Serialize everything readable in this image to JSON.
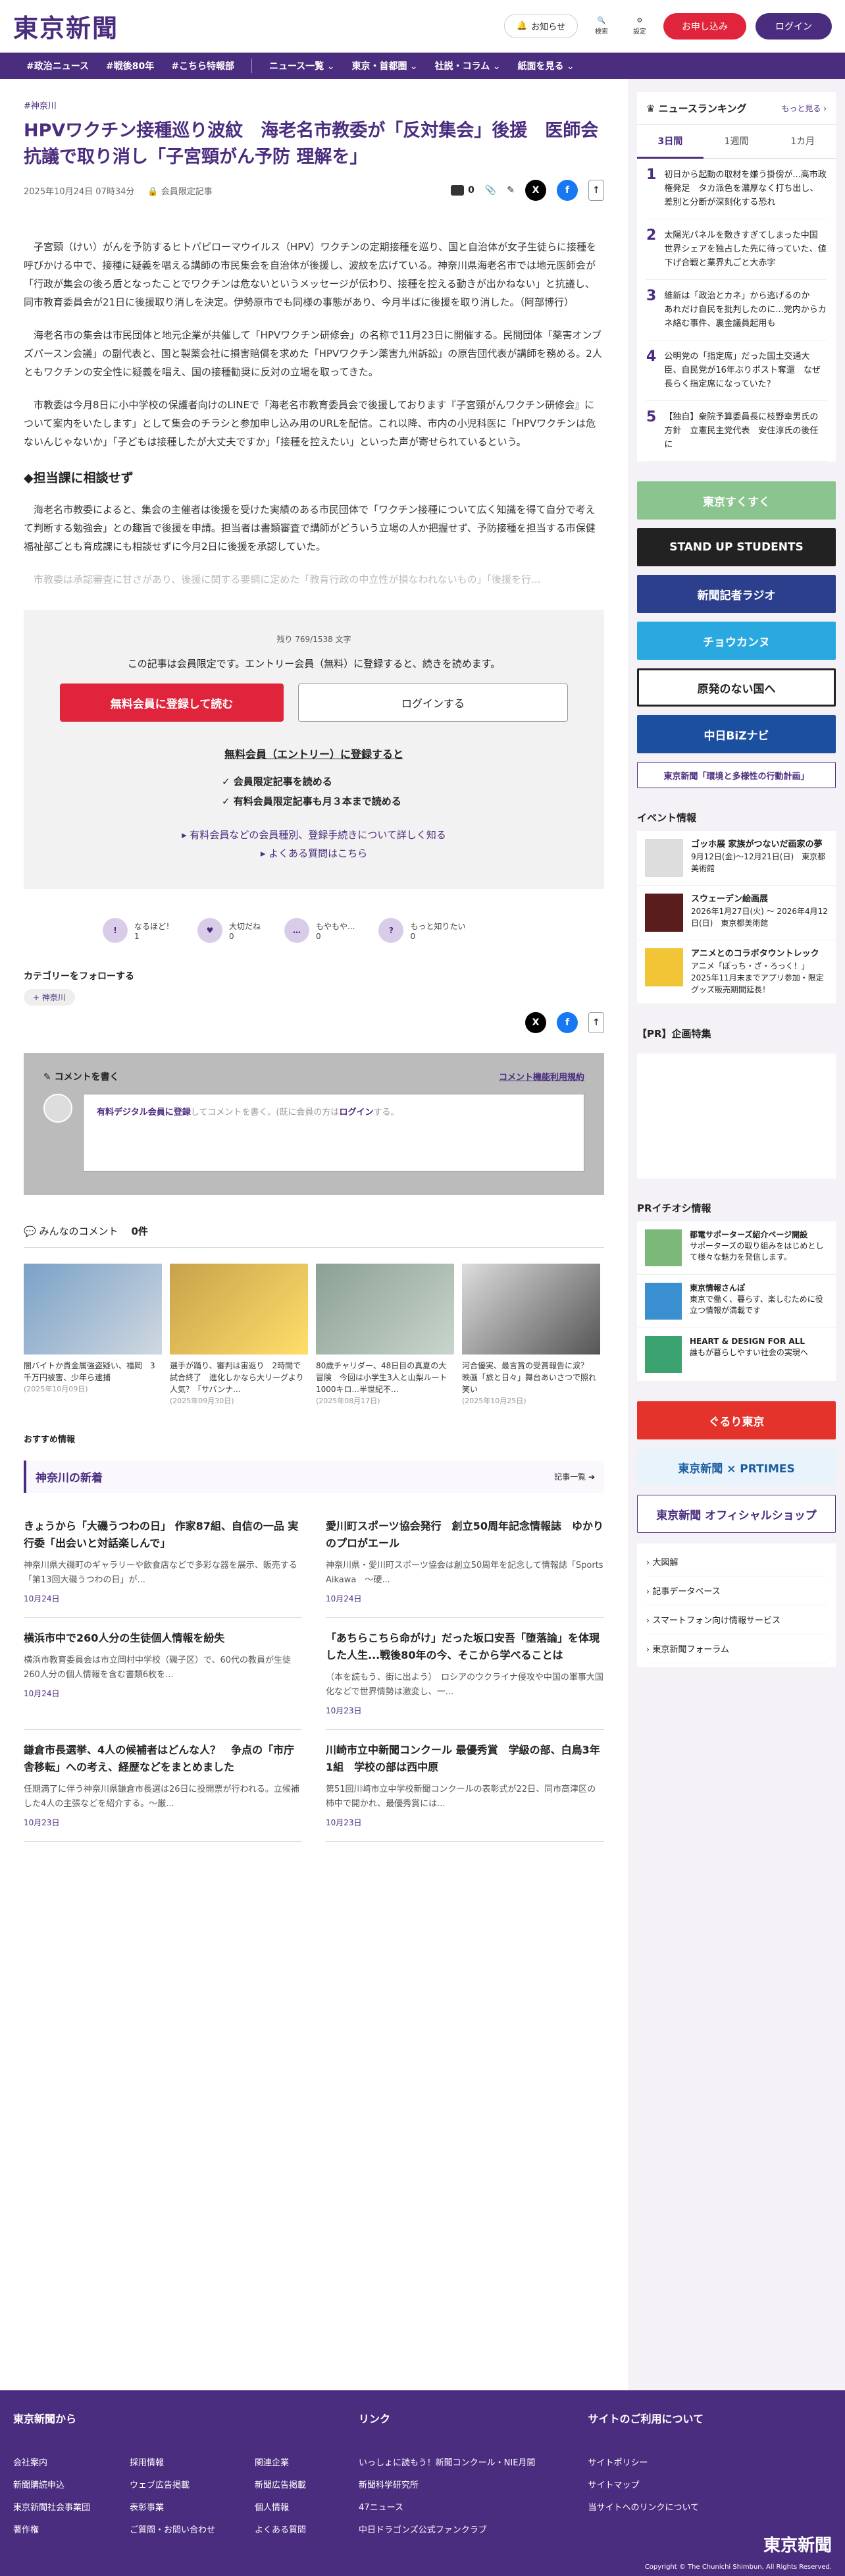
{
  "header": {
    "logo": "東京新聞",
    "notice": "お知らせ",
    "search": "検索",
    "settings": "設定",
    "apply": "お申し込み",
    "login": "ログイン"
  },
  "nav": [
    "#政治ニュース",
    "#戦後80年",
    "#こちら特報部",
    "ニュース一覧",
    "東京・首都圏",
    "社説・コラム",
    "紙面を見る"
  ],
  "article": {
    "tag": "#神奈川",
    "title": "HPVワクチン接種巡り波紋　海老名市教委が「反対集会」後援　医師会抗議で取り消し「子宮頸がん予防 理解を」",
    "date": "2025年10月24日 07時34分",
    "members_only": "会員限定記事",
    "comment_count": "0",
    "p1": "子宮頸（けい）がんを予防するヒトパピローマウイルス（HPV）ワクチンの定期接種を巡り、国と自治体が女子生徒らに接種を呼びかける中で、接種に疑義を唱える講師の市民集会を自治体が後援し、波紋を広げている。神奈川県海老名市では地元医師会が「行政が集会の後ろ盾となったことでワクチンは危ないというメッセージが伝わり、接種を控える動きが出かねない」と抗議し、同市教育委員会が21日に後援取り消しを決定。伊勢原市でも同様の事態があり、今月半ばに後援を取り消した。（阿部博行）",
    "p2": "海老名市の集会は市民団体と地元企業が共催して「HPVワクチン研修会」の名称で11月23日に開催する。民間団体「薬害オンブズパースン会議」の副代表と、国と製薬会社に損害賠償を求めた「HPVワクチン薬害九州訴訟」の原告団代表が講師を務める。2人ともワクチンの安全性に疑義を唱え、国の接種勧奨に反対の立場を取ってきた。",
    "p3": "市教委は今月8日に小中学校の保護者向けのLINEで「海老名市教育委員会で後援しております『子宮頸がんワクチン研修会』について案内をいたします」として集会のチラシと参加申し込み用のURLを配信。これ以降、市内の小児科医に「HPVワクチンは危ないんじゃないか」「子どもは接種したが大丈夫ですか」「接種を控えたい」といった声が寄せられているという。",
    "h2": "◆担当課に相談せず",
    "p4": "海老名市教委によると、集会の主催者は後援を受けた実績のある市民団体で「ワクチン接種について広く知識を得て自分で考えて判断する勉強会」との趣旨で後援を申請。担当者は書類審査で講師がどういう立場の人か把握せず、予防接種を担当する市保健福祉部ごとも育成課にも相談せずに今月2日に後援を承認していた。",
    "p5": "市教委は承認審査に甘さがあり、後援に関する要綱に定めた「教育行政の中立性が損なわれないもの」「後援を行..."
  },
  "paywall": {
    "remaining": "残り 769/1538 文字",
    "message": "この記事は会員限定です。エントリー会員（無料）に登録すると、続きを読めます。",
    "register": "無料会員に登録して読む",
    "login": "ログインする",
    "sub_title": "無料会員（エントリー）に登録すると",
    "benefits": [
      "会員限定記事を読める",
      "有料会員限定記事も月３本まで読める"
    ],
    "link1": "有料会員などの会員種別、登録手続きについて詳しく知る",
    "link2": "よくある質問はこちら"
  },
  "reactions": [
    {
      "label": "なるほど！",
      "count": "1"
    },
    {
      "label": "大切だね",
      "count": "0"
    },
    {
      "label": "もやもや...",
      "count": "0"
    },
    {
      "label": "もっと知りたい",
      "count": "0"
    }
  ],
  "follow": {
    "title": "カテゴリーをフォローする",
    "chip": "神奈川"
  },
  "comment": {
    "title": "コメントを書く",
    "terms": "コメント機能利用規約",
    "placeholder_link": "有料デジタル会員に登録",
    "placeholder": "してコメントを書く。(既に会員の方は",
    "login": "ログイン",
    "placeholder_end": "する。"
  },
  "all_comments": {
    "title": "みんなのコメント",
    "count": "0件"
  },
  "cards": [
    {
      "text": "闇バイトか貴金属強盗疑い、福岡　3千万円被害、少年ら逮捕",
      "date": "(2025年10月09日)"
    },
    {
      "text": "選手が踊り、審判は宙返り　2時間で試合終了　進化しかなら大リーグより人気？「サバンナ...",
      "date": "(2025年09月30日)"
    },
    {
      "text": "80歳チャリダー、48日目の真夏の大冒険　今回は小学生3人と山梨ルート1000キロ...半世紀不...",
      "date": "(2025年08月17日)"
    },
    {
      "text": "河合優実、最言賞の受賞報告に涙？　映画「旅と日々」舞台あいさつで照れ笑い",
      "date": "(2025年10月25日)"
    }
  ],
  "recommend": "おすすめ情報",
  "local": {
    "title": "神奈川の新着",
    "more": "記事一覧",
    "items": [
      {
        "title": "きょうから「大磯うつわの日」 作家87組、自信の一品 実行委「出会いと対話楽しんで」",
        "body": "神奈川県大磯町のギャラリーや飲食店などで多彩な器を展示、販売する「第13回大磯うつわの日」が...",
        "date": "10月24日"
      },
      {
        "title": "愛川町スポーツ協会発行　創立50周年記念情報誌　ゆかりのプロがエール",
        "body": "神奈川県・愛川町スポーツ協会は創立50周年を記念して情報誌「Sports Aikawa　～硬...",
        "date": "10月24日"
      },
      {
        "title": "横浜市中で260人分の生徒個人情報を紛失",
        "body": "横浜市教育委員会は市立岡村中学校（磯子区）で、60代の教員が生徒260人分の個人情報を含む書類6枚を...",
        "date": "10月24日"
      },
      {
        "title": "「あちらこちら命がけ」だった坂口安吾「堕落論」を体現した人生...戦後80年の今、そこから学べることは",
        "body": "（本を読もう、街に出よう）　ロシアのウクライナ侵攻や中国の軍事大国化などで世界情勢は激変し、一...",
        "date": "10月23日"
      },
      {
        "title": "鎌倉市長選挙、4人の候補者はどんな人？　争点の「市庁舎移転」への考え、経歴などをまとめました",
        "body": "任期満了に伴う神奈川県鎌倉市長選は26日に投開票が行われる。立候補した4人の主張などを紹介する。～厳...",
        "date": "10月23日"
      },
      {
        "title": "川崎市立中新聞コンクール 最優秀賞　学級の部、白鳥3年1組　学校の部は西中原",
        "body": "第51回川崎市立中学校新聞コンクールの表彰式が22日、同市高津区の柿中で開かれ、最優秀賞には...",
        "date": "10月23日"
      }
    ]
  },
  "sidebar": {
    "rank_title": "ニュースランキング",
    "rank_more": "もっと見る",
    "tabs": [
      "3日間",
      "1週間",
      "1カ月"
    ],
    "ranking": [
      "初日から起動の取材を嫌う掛傍が...高市政権発足　タカ派色を濃厚なく打ち出し、差別と分断が深刻化する恐れ",
      "太陽光パネルを敷きすぎてしまった中国　世界シェアを独占した先に待っていた、値下げ合戦と業界丸ごと大赤字",
      "維新は「政治とカネ」から逃げるのか　あれだけ自民を批判したのに...党内からカネ絡む事件、裏金議員起用も",
      "公明党の「指定席」だった国土交通大臣、自民党が16年ぶりポスト奪還　なぜ長らく指定席になっていた？",
      "【独自】衆院予算委員長に枝野幸男氏の方針　立憲民主党代表　安住淳氏の後任に"
    ],
    "banners": [
      "東京すくすく",
      "STAND UP STUDENTS",
      "新聞記者ラジオ",
      "チョウカンヌ",
      "原発のない国へ",
      "中日BiZナビ",
      "東京新聞「環境と多様性の行動計画」"
    ],
    "event_title": "イベント情報",
    "events": [
      {
        "title": "ゴッホ展 家族がつないだ画家の夢",
        "desc": "9月12日(金)～12月21日(日)　東京都美術館"
      },
      {
        "title": "スウェーデン絵画展",
        "desc": "2026年1月27日(火) ～ 2026年4月12日(日)　東京都美術館"
      },
      {
        "title": "アニメとのコラボタウントレック",
        "desc": "アニメ「ぽっち・ざ・ろっく！」2025年11月末までアプリ参加・限定グッズ販売期間延長！"
      }
    ],
    "pr_title": "【PR】企画特集",
    "pr2_title": "PRイチオシ情報",
    "pr_items": [
      {
        "title": "都電サポーターズ紹介ページ開設",
        "desc": "サポーターズの取り組みをはじめとして様々な魅力を発信します。"
      },
      {
        "title": "東京情報さんぽ",
        "desc": "東京で働く、暮らす、楽しむために役立つ情報が満載です"
      },
      {
        "title": "HEART & DESIGN FOR ALL",
        "desc": "誰もが暮らしやすい社会の実現へ"
      }
    ],
    "banners2": [
      "ぐるり東京",
      "東京新聞 × PRTIMES",
      "東京新聞 オフィシャルショップ"
    ],
    "links": [
      "大図解",
      "記事データベース",
      "スマートフォン向け情報サービス",
      "東京新聞フォーラム"
    ]
  },
  "footer": {
    "col1_title": "東京新聞から",
    "col1a": [
      "会社案内",
      "新聞購読申込",
      "東京新聞社会事業団",
      "著作権"
    ],
    "col1b": [
      "採用情報",
      "ウェブ広告掲載",
      "表彰事業",
      "ご質問・お問い合わせ"
    ],
    "col1c": [
      "関連企業",
      "新聞広告掲載",
      "個人情報",
      "よくある質問"
    ],
    "col2_title": "リンク",
    "col2": [
      "いっしょに読もう！新聞コンクール・NIE月間",
      "新聞科学研究所",
      "47ニュース",
      "中日ドラゴンズ公式ファンクラブ"
    ],
    "col3_title": "サイトのご利用について",
    "col3": [
      "サイトポリシー",
      "サイトマップ",
      "当サイトへのリンクについて"
    ],
    "logo": "東京新聞",
    "copyright": "Copyright © The Chunichi Shimbun, All Rights Reserved."
  }
}
